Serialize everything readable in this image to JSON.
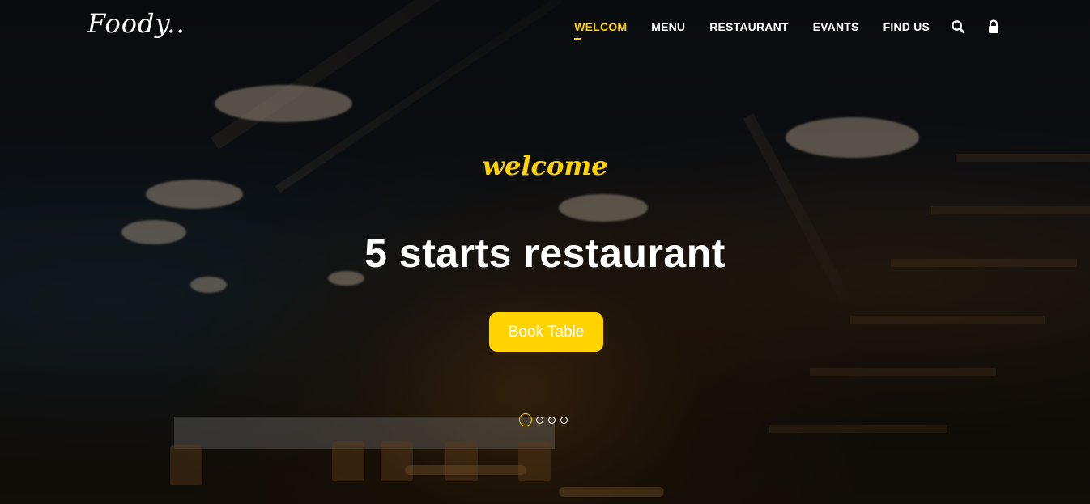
{
  "brand": {
    "logo_text": "Foody.."
  },
  "nav": {
    "items": [
      {
        "label": "WELCOM",
        "active": true
      },
      {
        "label": "MENU",
        "active": false
      },
      {
        "label": "RESTAURANT",
        "active": false
      },
      {
        "label": "EVANTS",
        "active": false
      },
      {
        "label": "FIND US",
        "active": false
      }
    ],
    "icons": [
      "search-icon",
      "lock-icon"
    ]
  },
  "hero": {
    "welcome_script": "welcome",
    "headline": "5 starts restaurant",
    "cta_label": "Book Table",
    "carousel": {
      "slide_count": 4,
      "active_index": 0
    }
  },
  "colors": {
    "accent": "#ffd200",
    "text": "#ffffff",
    "background": "#0b0d10"
  }
}
